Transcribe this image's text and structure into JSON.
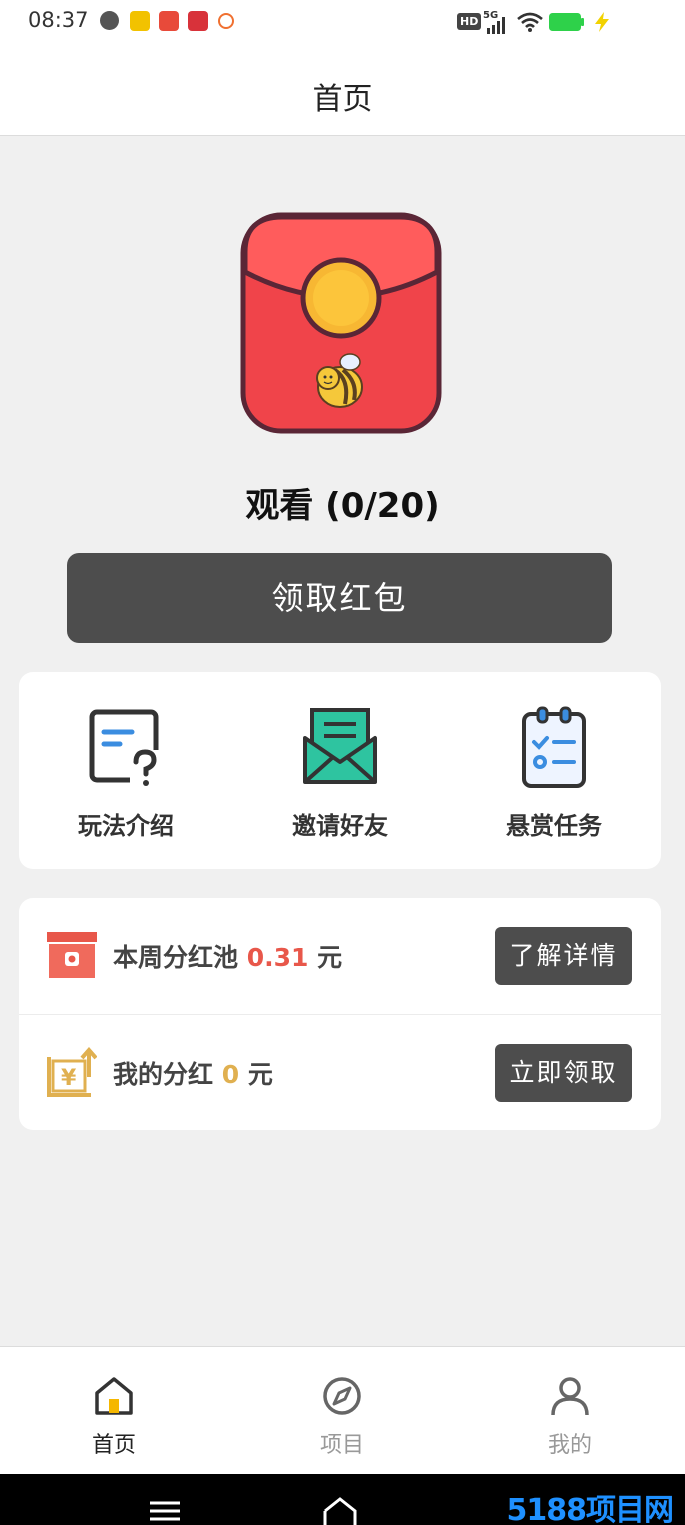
{
  "status_bar": {
    "time": "08:37",
    "network": "5G",
    "hd": "HD"
  },
  "header": {
    "title": "首页"
  },
  "watch": {
    "label": "观看 (0/20)"
  },
  "claim_button": {
    "label": "领取红包"
  },
  "features": [
    {
      "label": "玩法介绍",
      "icon": "help-doc-icon"
    },
    {
      "label": "邀请好友",
      "icon": "invite-envelope-icon"
    },
    {
      "label": "悬赏任务",
      "icon": "task-clipboard-icon"
    }
  ],
  "bonus_pool": {
    "label": "本周分红池",
    "amount": "0.31",
    "unit": "元",
    "button": "了解详情",
    "accent": "#e8574a"
  },
  "my_bonus": {
    "label": "我的分红",
    "amount": "0",
    "unit": "元",
    "button": "立即领取",
    "accent": "#e0b050"
  },
  "tabs": [
    {
      "label": "首页",
      "icon": "home-icon",
      "active": true
    },
    {
      "label": "项目",
      "icon": "compass-icon",
      "active": false
    },
    {
      "label": "我的",
      "icon": "user-icon",
      "active": false
    }
  ],
  "watermark": "5188项目网"
}
